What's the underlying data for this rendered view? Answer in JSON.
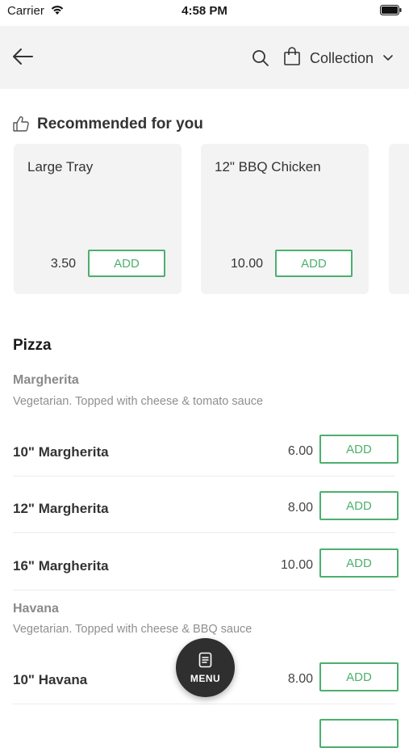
{
  "status_bar": {
    "carrier": "Carrier",
    "time": "4:58 PM"
  },
  "nav": {
    "mode_label": "Collection"
  },
  "recommended": {
    "title": "Recommended for you",
    "items": [
      {
        "name": "Large Tray",
        "price": "3.50",
        "add_label": "ADD"
      },
      {
        "name": "12\" BBQ Chicken",
        "price": "10.00",
        "add_label": "ADD"
      }
    ]
  },
  "menu": {
    "section_title": "Pizza",
    "groups": [
      {
        "name": "Margherita",
        "description": "Vegetarian. Topped with cheese & tomato sauce",
        "items": [
          {
            "name": "10\" Margherita",
            "price": "6.00",
            "add_label": "ADD"
          },
          {
            "name": "12\" Margherita",
            "price": "8.00",
            "add_label": "ADD"
          },
          {
            "name": "16\" Margherita",
            "price": "10.00",
            "add_label": "ADD"
          }
        ]
      },
      {
        "name": "Havana",
        "description": "Vegetarian. Topped with cheese & BBQ sauce",
        "items": [
          {
            "name": "10\" Havana",
            "price": "8.00",
            "add_label": "ADD"
          }
        ]
      }
    ]
  },
  "fab": {
    "label": "MENU"
  },
  "colors": {
    "accent": "#4caf6d",
    "nav_bg": "#f3f3f3",
    "fab_bg": "#2f2f2f"
  }
}
